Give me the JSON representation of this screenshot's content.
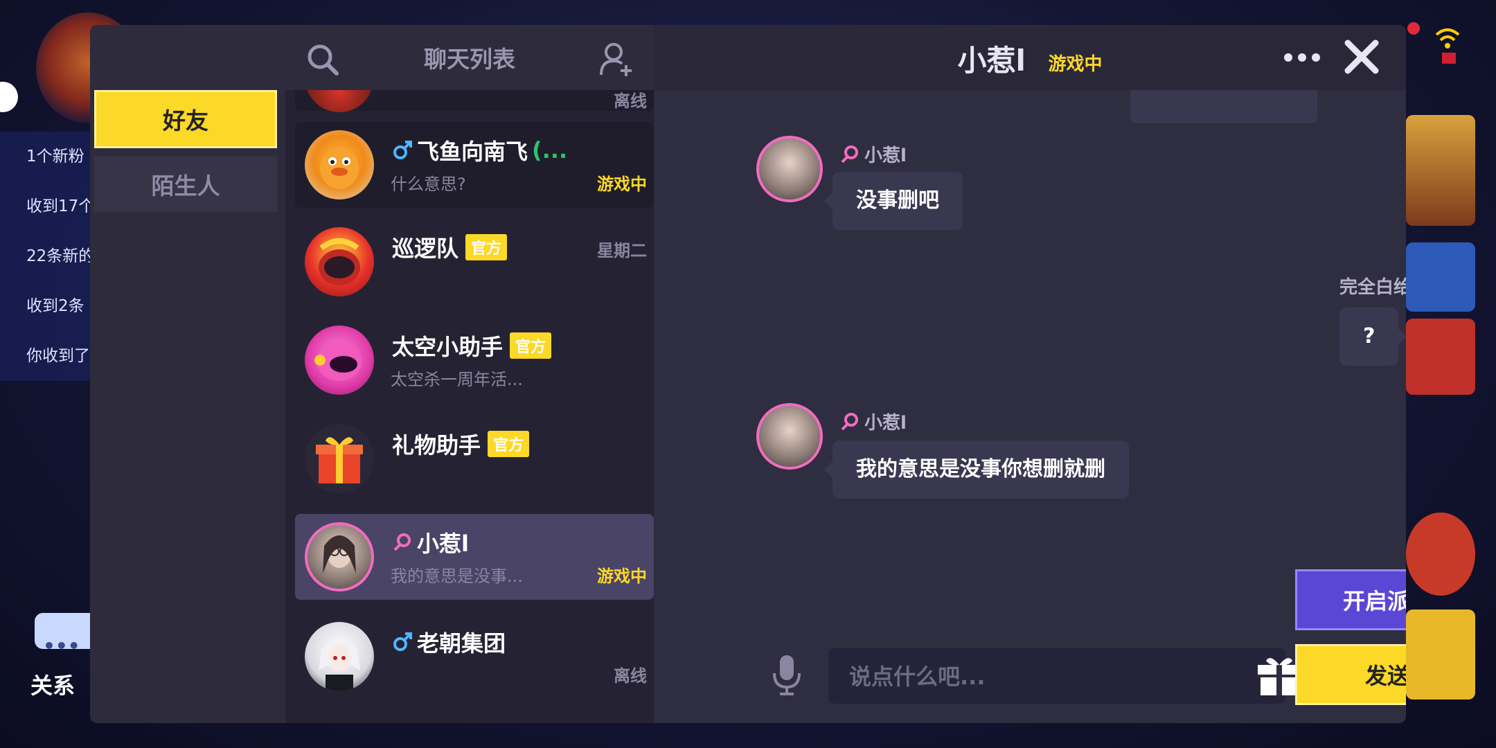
{
  "background": {
    "notifications": [
      "1个新粉",
      "收到17个",
      "22条新的",
      "收到2条",
      "你收到了"
    ],
    "relations_label": "关系"
  },
  "nav": {
    "tabs": [
      {
        "label": "好友",
        "active": true
      },
      {
        "label": "陌生人",
        "active": false
      }
    ]
  },
  "list": {
    "title": "聊天列表",
    "items": [
      {
        "name": "",
        "status": "离线",
        "status_type": "offline"
      },
      {
        "name": "飞鱼向南飞",
        "gender": "male",
        "online_tag": "(...",
        "preview": "什么意思?",
        "status": "游戏中",
        "status_type": "ingame"
      },
      {
        "name": "巡逻队",
        "badge": "官方",
        "date": "星期二"
      },
      {
        "name": "太空小助手",
        "badge": "官方",
        "preview": "太空杀一周年活..."
      },
      {
        "name": "礼物助手",
        "badge": "官方"
      },
      {
        "name": "小惹l",
        "gender": "female",
        "preview": "我的意思是没事...",
        "status": "游戏中",
        "status_type": "ingame"
      },
      {
        "name": "老朝集团",
        "gender": "male",
        "status": "离线",
        "status_type": "offline"
      }
    ]
  },
  "chat": {
    "title": "小惹l",
    "title_status": "游戏中",
    "messages": [
      {
        "side": "left",
        "sender": "小惹l",
        "text": "没事删吧"
      },
      {
        "side": "right",
        "sender": "完全白给",
        "text": "?"
      },
      {
        "side": "left",
        "sender": "小惹l",
        "text": "我的意思是没事你想删就删"
      }
    ],
    "input_placeholder": "说点什么吧...",
    "party_button": "开启派对",
    "send_button": "发送"
  },
  "colors": {
    "accent_yellow": "#fcd827",
    "party_purple": "#5b46d6",
    "female_pink": "#f06cc0",
    "male_blue": "#4fb6ff",
    "online_green": "#2ac46a"
  }
}
